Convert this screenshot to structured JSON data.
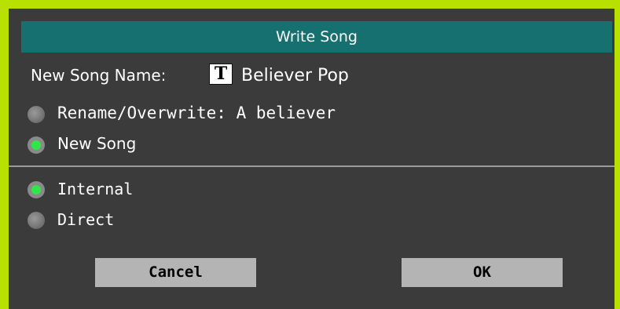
{
  "dialog": {
    "title": "Write Song",
    "new_song_name_label": "New Song Name:",
    "text_edit_icon_glyph": "T",
    "new_song_name_value": "Believer Pop",
    "options": {
      "rename_overwrite": {
        "label": "Rename/Overwrite: A believer",
        "selected": false
      },
      "new_song": {
        "label": "New Song",
        "selected": true
      }
    },
    "destinations": {
      "internal": {
        "label": "Internal",
        "selected": true
      },
      "direct": {
        "label": "Direct",
        "selected": false
      }
    },
    "buttons": {
      "cancel": "Cancel",
      "ok": "OK"
    }
  },
  "colors": {
    "frame_accent": "#b8e000",
    "title_bar": "#16706f",
    "background": "#3b3b3b",
    "radio_selected": "#2ee84a",
    "button_bg": "#b4b4b4"
  }
}
